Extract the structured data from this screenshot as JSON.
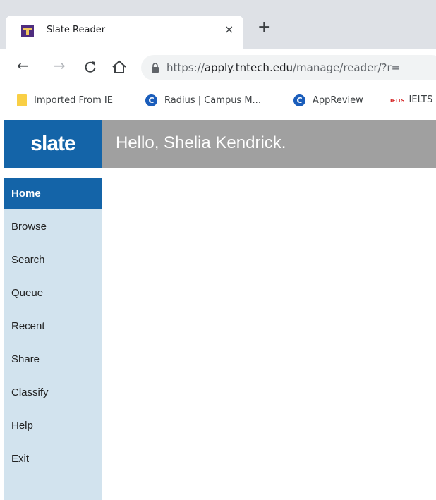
{
  "browser": {
    "tab_title": "Slate Reader",
    "close_glyph": "×",
    "new_tab_glyph": "+",
    "url_scheme": "https://",
    "url_host": "apply.tntech.edu",
    "url_path": "/manage/reader/?r=",
    "bookmarks": [
      {
        "label": "Imported From IE",
        "icon": "folder-icon"
      },
      {
        "label": "Radius | Campus M...",
        "icon": "campus-c-icon",
        "icon_letter": "C"
      },
      {
        "label": "AppReview",
        "icon": "campus-c-icon",
        "icon_letter": "C"
      },
      {
        "label": "IELTS",
        "icon": "ielts-icon",
        "icon_text": "IELTS"
      }
    ]
  },
  "app": {
    "brand": "slate",
    "greeting": "Hello, Shelia Kendrick.",
    "nav": [
      {
        "label": "Home",
        "active": true
      },
      {
        "label": "Browse"
      },
      {
        "label": "Search"
      },
      {
        "label": "Queue"
      },
      {
        "label": "Recent"
      },
      {
        "label": "Share"
      },
      {
        "label": "Classify"
      },
      {
        "label": "Help"
      },
      {
        "label": "Exit"
      }
    ]
  },
  "colors": {
    "brand_blue": "#1464a8",
    "header_gray": "#a0a0a0",
    "sidebar_bg": "#d2e3ee",
    "tab_strip": "#dee1e6"
  }
}
